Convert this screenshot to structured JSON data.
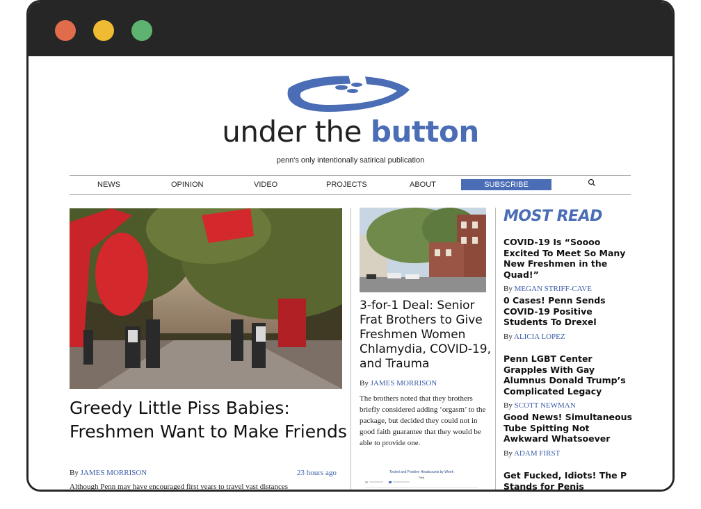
{
  "window": {
    "controls": [
      "close",
      "minimize",
      "maximize"
    ]
  },
  "site": {
    "title_plain": "under the ",
    "title_accent": "button",
    "tagline": "penn's only intentionally satirical publication",
    "brand_color": "#4a6db5"
  },
  "nav": {
    "items": [
      "NEWS",
      "OPINION",
      "VIDEO",
      "PROJECTS",
      "ABOUT"
    ],
    "subscribe": "SUBSCRIBE",
    "search_icon": "search-icon"
  },
  "hero": {
    "title": "Greedy Little Piss Babies: Freshmen Want to Make Friends",
    "by": "By ",
    "author": "JAMES MORRISON",
    "time": "23 hours ago",
    "excerpt": "Although Penn may have encouraged first years to travel vast distances"
  },
  "middle": {
    "title": "3-for-1 Deal: Senior Frat Brothers to Give Freshmen Women Chlamydia, COVID-19, and Trauma",
    "by": "By ",
    "author": "JAMES MORRISON",
    "excerpt": "The brothers noted that they brothers briefly considered adding ‘orgasm’ to the package, but decided they could not in good faith guarantee that they would be able to provide one.",
    "chart_title": "Tested and Positive Headcounts by Week",
    "chart_sub": "Total"
  },
  "most_read": {
    "heading": "MOST READ",
    "items": [
      {
        "title": "COVID-19 Is “Soooo Excited To Meet So Many New Freshmen in the Quad!”",
        "by": "By ",
        "author": "MEGAN STRIFF-CAVE"
      },
      {
        "title": "0 Cases! Penn Sends COVID-19 Positive Students To Drexel",
        "by": "By ",
        "author": "ALICIA LOPEZ"
      },
      {
        "title": "Penn LGBT Center Grapples With Gay Alumnus Donald Trump’s Complicated Legacy",
        "by": "By ",
        "author": "SCOTT NEWMAN"
      },
      {
        "title": "Good News! Simultaneous Tube Spitting Not Awkward Whatsoever",
        "by": "By ",
        "author": "ADAM FIRST"
      },
      {
        "title": "Get Fucked, Idiots! The P Stands for Penis",
        "by": "",
        "author": ""
      }
    ]
  }
}
